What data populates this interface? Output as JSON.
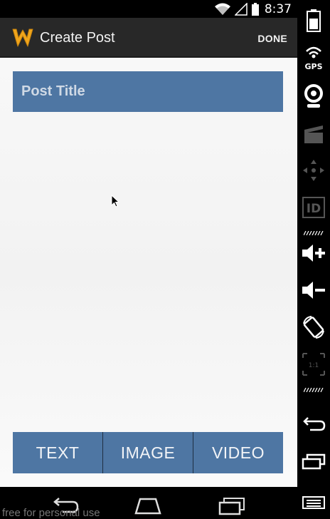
{
  "status_bar": {
    "time": "8:37",
    "icons": [
      "wifi-icon",
      "signal-icon",
      "battery-icon"
    ]
  },
  "action_bar": {
    "title": "Create Post",
    "done_label": "DONE",
    "logo_icon": "wimp-w-logo-icon"
  },
  "form": {
    "title_placeholder": "Post Title",
    "title_value": ""
  },
  "post_types": {
    "tabs": [
      {
        "label": "TEXT"
      },
      {
        "label": "IMAGE"
      },
      {
        "label": "VIDEO"
      }
    ]
  },
  "nav_bar": {
    "buttons": [
      "back-icon",
      "home-icon",
      "recents-icon"
    ]
  },
  "watermark": "free for personal use",
  "side_panel": {
    "buttons": [
      {
        "name": "battery-icon"
      },
      {
        "name": "gps-icon",
        "label": "GPS"
      },
      {
        "name": "camera-icon"
      },
      {
        "name": "video-clapper-icon"
      },
      {
        "name": "dpad-icon"
      },
      {
        "name": "id-icon",
        "label": "ID"
      },
      {
        "name": "volume-up-icon"
      },
      {
        "name": "volume-down-icon"
      },
      {
        "name": "rotate-icon"
      },
      {
        "name": "scale-icon",
        "label": "1:1"
      },
      {
        "name": "back-icon"
      },
      {
        "name": "recents-icon"
      },
      {
        "name": "menu-icon"
      }
    ]
  },
  "colors": {
    "accent": "#4e76a3",
    "action_bar": "#282828",
    "background": "#f4f4f4",
    "logo": "#f0a51c"
  }
}
